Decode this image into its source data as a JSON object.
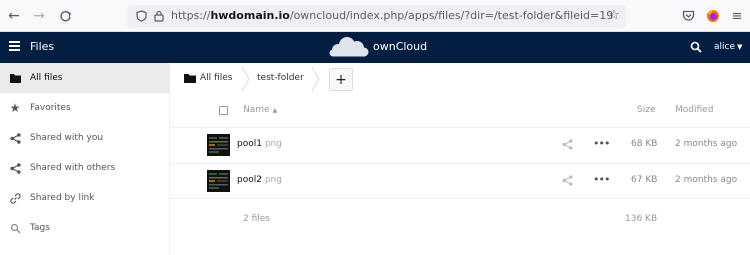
{
  "browser": {
    "url_domain": "hwdomain.io",
    "url_prefix": "https://",
    "url_path": "/owncloud/index.php/apps/files/?dir=/test-folder&fileid=19"
  },
  "header": {
    "app_title": "Files",
    "brand": "ownCloud",
    "user": "alice",
    "bg_color": "#041e42"
  },
  "sidebar": {
    "items": [
      {
        "label": "All files",
        "icon": "folder-icon",
        "active": true
      },
      {
        "label": "Favorites",
        "icon": "star-icon"
      },
      {
        "label": "Shared with you",
        "icon": "share-icon"
      },
      {
        "label": "Shared with others",
        "icon": "share-icon"
      },
      {
        "label": "Shared by link",
        "icon": "link-icon"
      },
      {
        "label": "Tags",
        "icon": "tag-icon"
      }
    ]
  },
  "breadcrumb": {
    "home_label": "All files",
    "folder": "test-folder",
    "add_label": "+"
  },
  "table": {
    "headers": {
      "name": "Name",
      "sort": "▲",
      "size": "Size",
      "modified": "Modified"
    },
    "rows": [
      {
        "name": "pool1",
        "ext": " png",
        "size": "68 KB",
        "modified": "2 months ago"
      },
      {
        "name": "pool2",
        "ext": " png",
        "size": "67 KB",
        "modified": "2 months ago"
      }
    ],
    "summary": {
      "count": "2 files",
      "total": "136 KB"
    }
  }
}
